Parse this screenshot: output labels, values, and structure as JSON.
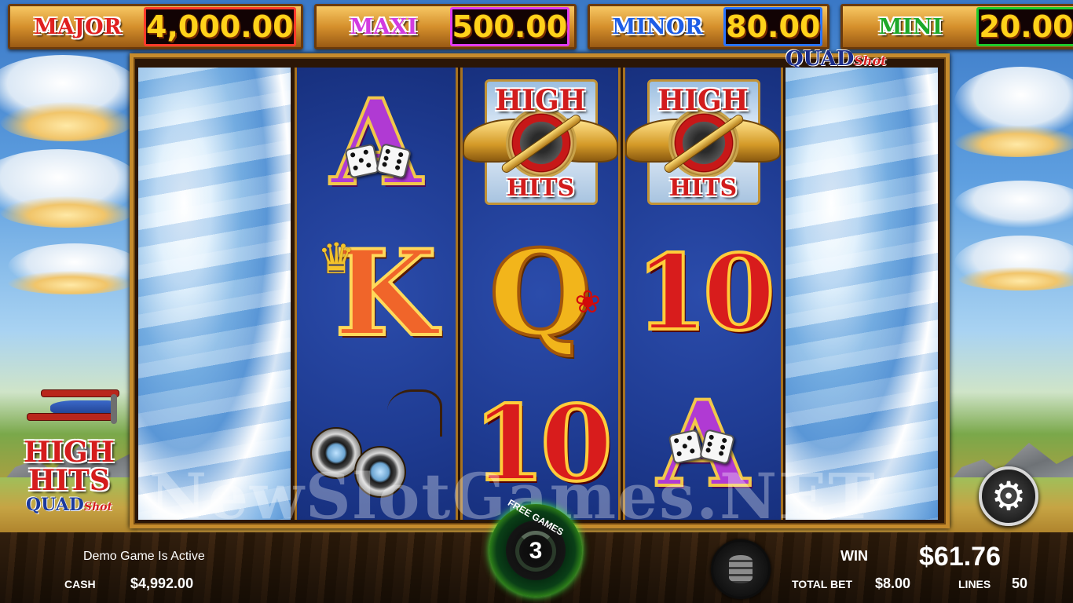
{
  "jackpots": [
    {
      "label": "MAJOR",
      "value": "4,000.00"
    },
    {
      "label": "MAXI",
      "value": "500.00"
    },
    {
      "label": "MINOR",
      "value": "80.00"
    },
    {
      "label": "MINI",
      "value": "20.00"
    }
  ],
  "badge": {
    "quad": "QUAD",
    "shot": "Shot"
  },
  "reels": [
    {
      "type": "wild-sky"
    },
    {
      "symbols": [
        "A",
        "K",
        "binoculars"
      ]
    },
    {
      "symbols": [
        "high-hits-logo",
        "Q",
        "10"
      ]
    },
    {
      "symbols": [
        "high-hits-logo",
        "10",
        "A"
      ]
    },
    {
      "type": "wild-sky"
    }
  ],
  "symbol_text": {
    "A": "A",
    "K": "K",
    "Q": "Q",
    "ten": "10",
    "hh_top": "HIGH",
    "hh_bot": "HITS"
  },
  "left_logo": {
    "line1": "HIGH",
    "line2": "HITS",
    "line3": "QUAD",
    "line3b": "Shot"
  },
  "watermark": "NewSlotGames.NET",
  "status": {
    "demo": "Demo Game Is Active"
  },
  "cash": {
    "label": "CASH",
    "value": "$4,992.00"
  },
  "free_games": {
    "label": "FREE GAMES",
    "count": "3"
  },
  "win": {
    "label": "WIN",
    "value": "$61.76"
  },
  "total_bet": {
    "label": "TOTAL BET",
    "value": "$8.00"
  },
  "lines": {
    "label": "LINES",
    "value": "50"
  },
  "icons": {
    "settings": "gear-icon",
    "bet": "coin-stack-icon"
  },
  "colors": {
    "major": "#e02020",
    "maxi": "#d23be0",
    "minor": "#1d5de6",
    "mini": "#1ea82a",
    "jackpot_value": "#ffd21a"
  }
}
